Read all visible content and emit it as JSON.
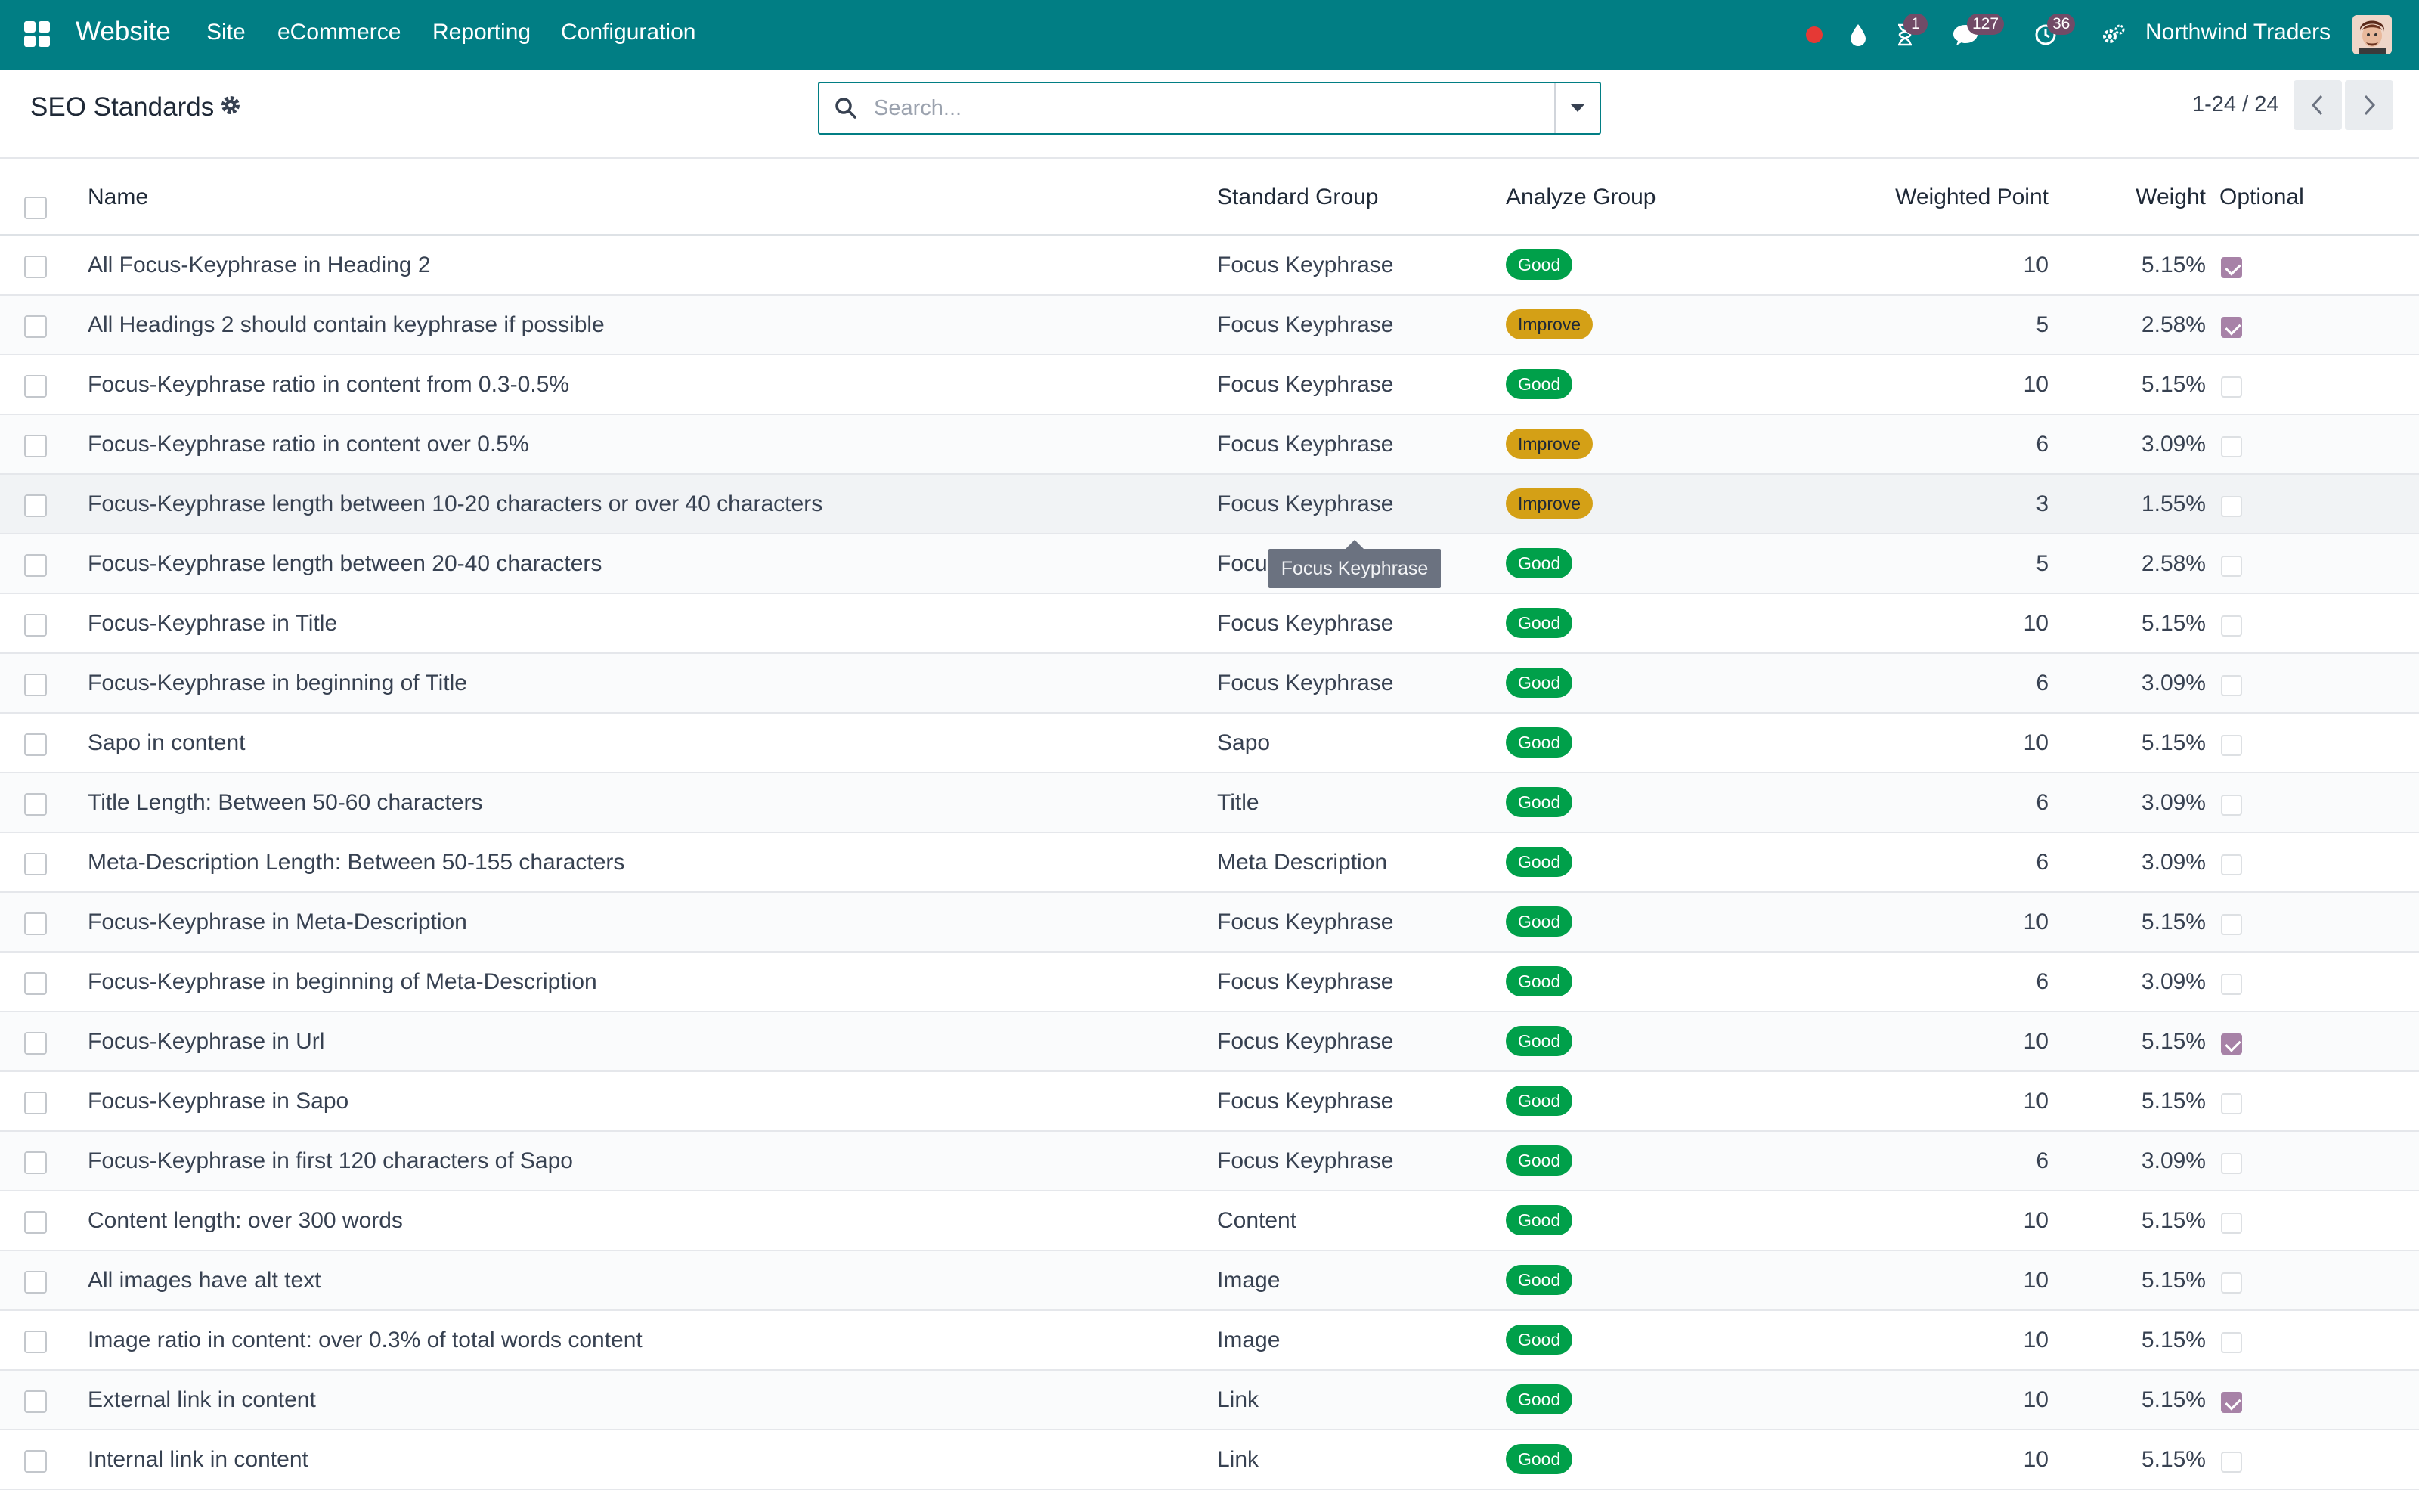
{
  "navbar": {
    "brand": "Website",
    "menus": [
      "Site",
      "eCommerce",
      "Reporting",
      "Configuration"
    ],
    "icons": [
      "apps-icon",
      "status-dot-icon",
      "droplet-icon",
      "hourglass-icon",
      "chat-icon",
      "clock-icon",
      "settings-icon"
    ],
    "badges": {
      "activities": "1",
      "messages": "127",
      "clock": "36"
    },
    "company": "Northwind Traders",
    "colors": {
      "bar": "#017e84",
      "badge": "#714b67",
      "status_dot": "#e53935"
    }
  },
  "control_panel": {
    "title": "SEO Standards",
    "search_placeholder": "Search...",
    "pager": "1-24 / 24"
  },
  "table": {
    "columns": {
      "name": "Name",
      "standard_group": "Standard Group",
      "analyze_group": "Analyze Group",
      "weighted_point": "Weighted Point",
      "weight": "Weight",
      "optional": "Optional"
    },
    "badge_colors": {
      "Good": "#00a04a",
      "Improve": "#d4a016"
    },
    "rows": [
      {
        "name": "All Focus-Keyphrase in Heading 2",
        "group": "Focus Keyphrase",
        "analyze": "Good",
        "point": "10",
        "weight": "5.15%",
        "optional": true
      },
      {
        "name": "All Headings 2 should contain keyphrase if possible",
        "group": "Focus Keyphrase",
        "analyze": "Improve",
        "point": "5",
        "weight": "2.58%",
        "optional": true
      },
      {
        "name": "Focus-Keyphrase ratio in content from 0.3-0.5%",
        "group": "Focus Keyphrase",
        "analyze": "Good",
        "point": "10",
        "weight": "5.15%",
        "optional": false
      },
      {
        "name": "Focus-Keyphrase ratio in content over 0.5%",
        "group": "Focus Keyphrase",
        "analyze": "Improve",
        "point": "6",
        "weight": "3.09%",
        "optional": false
      },
      {
        "name": "Focus-Keyphrase length between 10-20 characters or over 40 characters",
        "group": "Focus Keyphrase",
        "analyze": "Improve",
        "point": "3",
        "weight": "1.55%",
        "optional": false
      },
      {
        "name": "Focus-Keyphrase length between 20-40 characters",
        "group": "Focus Keyphrase",
        "analyze": "Good",
        "point": "5",
        "weight": "2.58%",
        "optional": false
      },
      {
        "name": "Focus-Keyphrase in Title",
        "group": "Focus Keyphrase",
        "analyze": "Good",
        "point": "10",
        "weight": "5.15%",
        "optional": false
      },
      {
        "name": "Focus-Keyphrase in beginning of Title",
        "group": "Focus Keyphrase",
        "analyze": "Good",
        "point": "6",
        "weight": "3.09%",
        "optional": false
      },
      {
        "name": "Sapo in content",
        "group": "Sapo",
        "analyze": "Good",
        "point": "10",
        "weight": "5.15%",
        "optional": false
      },
      {
        "name": "Title Length: Between 50-60 characters",
        "group": "Title",
        "analyze": "Good",
        "point": "6",
        "weight": "3.09%",
        "optional": false
      },
      {
        "name": "Meta-Description Length: Between 50-155 characters",
        "group": "Meta Description",
        "analyze": "Good",
        "point": "6",
        "weight": "3.09%",
        "optional": false
      },
      {
        "name": "Focus-Keyphrase in Meta-Description",
        "group": "Focus Keyphrase",
        "analyze": "Good",
        "point": "10",
        "weight": "5.15%",
        "optional": false
      },
      {
        "name": "Focus-Keyphrase in beginning of Meta-Description",
        "group": "Focus Keyphrase",
        "analyze": "Good",
        "point": "6",
        "weight": "3.09%",
        "optional": false
      },
      {
        "name": "Focus-Keyphrase in Url",
        "group": "Focus Keyphrase",
        "analyze": "Good",
        "point": "10",
        "weight": "5.15%",
        "optional": true
      },
      {
        "name": "Focus-Keyphrase in Sapo",
        "group": "Focus Keyphrase",
        "analyze": "Good",
        "point": "10",
        "weight": "5.15%",
        "optional": false
      },
      {
        "name": "Focus-Keyphrase in first 120 characters of Sapo",
        "group": "Focus Keyphrase",
        "analyze": "Good",
        "point": "6",
        "weight": "3.09%",
        "optional": false
      },
      {
        "name": "Content length: over 300 words",
        "group": "Content",
        "analyze": "Good",
        "point": "10",
        "weight": "5.15%",
        "optional": false
      },
      {
        "name": "All images have alt text",
        "group": "Image",
        "analyze": "Good",
        "point": "10",
        "weight": "5.15%",
        "optional": false
      },
      {
        "name": "Image ratio in content: over 0.3% of total words content",
        "group": "Image",
        "analyze": "Good",
        "point": "10",
        "weight": "5.15%",
        "optional": false
      },
      {
        "name": "External link in content",
        "group": "Link",
        "analyze": "Good",
        "point": "10",
        "weight": "5.15%",
        "optional": true
      },
      {
        "name": "Internal link in content",
        "group": "Link",
        "analyze": "Good",
        "point": "10",
        "weight": "5.15%",
        "optional": false
      }
    ]
  },
  "tooltip": {
    "text": "Focus Keyphrase"
  }
}
